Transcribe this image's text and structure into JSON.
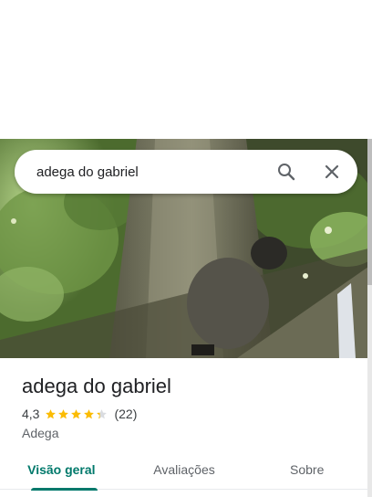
{
  "search": {
    "value": "adega do gabriel",
    "search_icon": "search-icon",
    "close_icon": "close-icon"
  },
  "photo": {
    "description_icon": "place-photo"
  },
  "place": {
    "title": "adega do gabriel",
    "rating": "4,3",
    "rating_value": 4.3,
    "reviews": "(22)",
    "category": "Adega"
  },
  "tabs": [
    {
      "label": "Visão geral",
      "active": true
    },
    {
      "label": "Avaliações",
      "active": false
    },
    {
      "label": "Sobre",
      "active": false
    }
  ],
  "colors": {
    "accent": "#00796b",
    "star": "#fbbc04",
    "star_empty": "#dadce0"
  }
}
